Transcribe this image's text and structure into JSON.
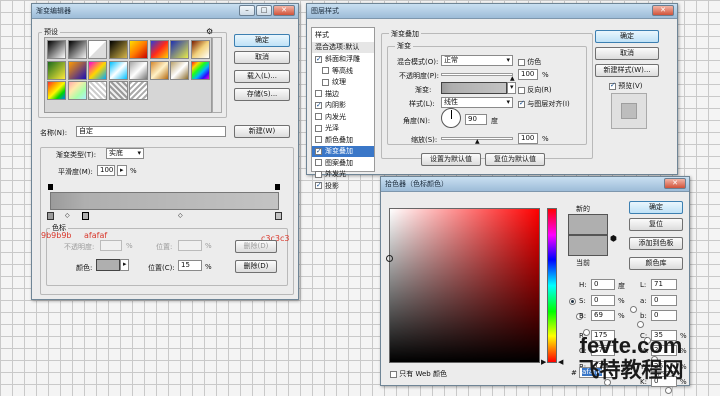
{
  "gradient_editor": {
    "title": "渐变编辑器",
    "presets_label": "预设",
    "gear": "⚙",
    "ok": "确定",
    "cancel": "取消",
    "load": "载入(L)...",
    "save": "存储(S)...",
    "name_label": "名称(N):",
    "name_value": "自定",
    "new_button": "新建(W)",
    "type_label": "渐变类型(T):",
    "type_value": "实底",
    "smooth_label": "平滑度(M):",
    "smooth_value": "100",
    "smooth_unit": "%",
    "stops_group": "色标",
    "opacity_label": "不透明度:",
    "opacity_unit": "%",
    "location_label": "位置:",
    "delete_label": "删除(D)",
    "color_label": "颜色:",
    "color_location_label": "位置(C):",
    "color_location_value": "15",
    "color_location_unit": "%",
    "color_delete": "删除(D)",
    "annotations": [
      "9b9b9b",
      "afafaf",
      "c3c3c3"
    ],
    "preset_gradients": [
      "linear-gradient(135deg,#000,#fff)",
      "linear-gradient(135deg,#000,#f4f4f4)",
      "linear-gradient(135deg,#fff 0,#fff 49%,#ddd 51%)",
      "linear-gradient(135deg,#000,#d7b74a)",
      "linear-gradient(135deg,#ffdd00,#ff7a00,#c80000)",
      "linear-gradient(135deg,#2a3dd9,#ff2a1a,#ffd000)",
      "linear-gradient(135deg,#1d2fb0,#e8eb4b)",
      "linear-gradient(135deg,#7a1d00,#f1d17a,#fff)",
      "linear-gradient(135deg,#1b6b1b,#ffeb3b)",
      "linear-gradient(135deg,#ff9b00,#1a0fb8)",
      "linear-gradient(135deg,#ff00d2,#ffd600,#00a8ff)",
      "linear-gradient(135deg,#00c0ff,#ffffff,#00c0ff)",
      "linear-gradient(135deg,#a9a9a9,#fff,#777)",
      "linear-gradient(135deg,#d68a2f,#fff1c7,#b46b12)",
      "linear-gradient(135deg,#bba36c,#fff,#8c6d2f)",
      "linear-gradient(135deg,#ff1a1a,#ffd400,#1aff1a,#00b3ff,#2a0dff,#ff00d4)",
      "linear-gradient(135deg,#ff2d2d,#ff9b00,#fff600,#00d600,#0078ff)",
      "linear-gradient(135deg,#ffaaaa,#ffeaaa,#aaffaa,#aaeeff)",
      "repeating-linear-gradient(45deg,#ccc 0 2px,#fff 2px 4px)",
      "repeating-linear-gradient(45deg,#999 0 2px,#eee 2px 4px)",
      "repeating-linear-gradient(135deg,#aaa 0 2px,#fff 2px 4px)"
    ]
  },
  "layer_style": {
    "title": "图层样式",
    "styles_header": "样式",
    "blend_header": "混合选项:默认",
    "items": [
      {
        "label": "斜面和浮雕",
        "checked": true
      },
      {
        "label": "等高线",
        "checked": false,
        "indent": true
      },
      {
        "label": "纹理",
        "checked": false,
        "indent": true
      },
      {
        "label": "描边",
        "checked": false
      },
      {
        "label": "内阴影",
        "checked": true
      },
      {
        "label": "内发光",
        "checked": false
      },
      {
        "label": "光泽",
        "checked": false
      },
      {
        "label": "颜色叠加",
        "checked": false
      },
      {
        "label": "渐变叠加",
        "checked": true,
        "selected": true
      },
      {
        "label": "图案叠加",
        "checked": false
      },
      {
        "label": "外发光",
        "checked": false
      },
      {
        "label": "投影",
        "checked": true
      }
    ],
    "section_title": "渐变叠加",
    "group_title": "渐变",
    "blend_mode_label": "混合模式(O):",
    "blend_mode_value": "正常",
    "dither_label": "仿色",
    "opacity_label": "不透明度(P):",
    "opacity_value": "100",
    "gradient_label": "渐变:",
    "reverse_label": "反向(R)",
    "style_label": "样式(L):",
    "style_value": "线性",
    "align_label": "与图层对齐(I)",
    "angle_label": "角度(N):",
    "angle_value": "90",
    "angle_unit": "度",
    "scale_label": "缩放(S):",
    "scale_value": "100",
    "percent": "%",
    "set_default": "设置为默认值",
    "reset_default": "复位为默认值",
    "ok": "确定",
    "cancel": "取消",
    "new_style": "新建样式(W)...",
    "preview_label": "预览(V)"
  },
  "color_picker": {
    "title": "拾色器（色标颜色）",
    "new_label": "新的",
    "current_label": "当前",
    "ok": "确定",
    "reset": "复位",
    "add_swatch": "添加到色板",
    "libraries": "颜色库",
    "fields": [
      {
        "label": "H:",
        "value": "0",
        "unit": "度",
        "on": true
      },
      {
        "label": "S:",
        "value": "0",
        "unit": "%",
        "on": false
      },
      {
        "label": "B:",
        "value": "69",
        "unit": "%",
        "on": false
      },
      {
        "label": "R:",
        "value": "175",
        "unit": "",
        "on": false
      },
      {
        "label": "G:",
        "value": "175",
        "unit": "",
        "on": false
      },
      {
        "label": "B:",
        "value": "175",
        "unit": "",
        "on": false
      }
    ],
    "lab_fields": [
      {
        "label": "L:",
        "value": "71",
        "unit": ""
      },
      {
        "label": "a:",
        "value": "0",
        "unit": ""
      },
      {
        "label": "b:",
        "value": "0",
        "unit": ""
      },
      {
        "label": "C:",
        "value": "35",
        "unit": "%"
      },
      {
        "label": "M:",
        "value": "27",
        "unit": "%"
      },
      {
        "label": "Y:",
        "value": "26",
        "unit": "%"
      },
      {
        "label": "K:",
        "value": "0",
        "unit": "%"
      }
    ],
    "hex_prefix": "#",
    "hex_value": "afafaf",
    "web_only_label": "只有 Web 颜色",
    "new_color": "#afafaf",
    "current_color": "#afafaf"
  },
  "watermark": {
    "line1": "fevte.com",
    "line2": "飞特教程网"
  }
}
